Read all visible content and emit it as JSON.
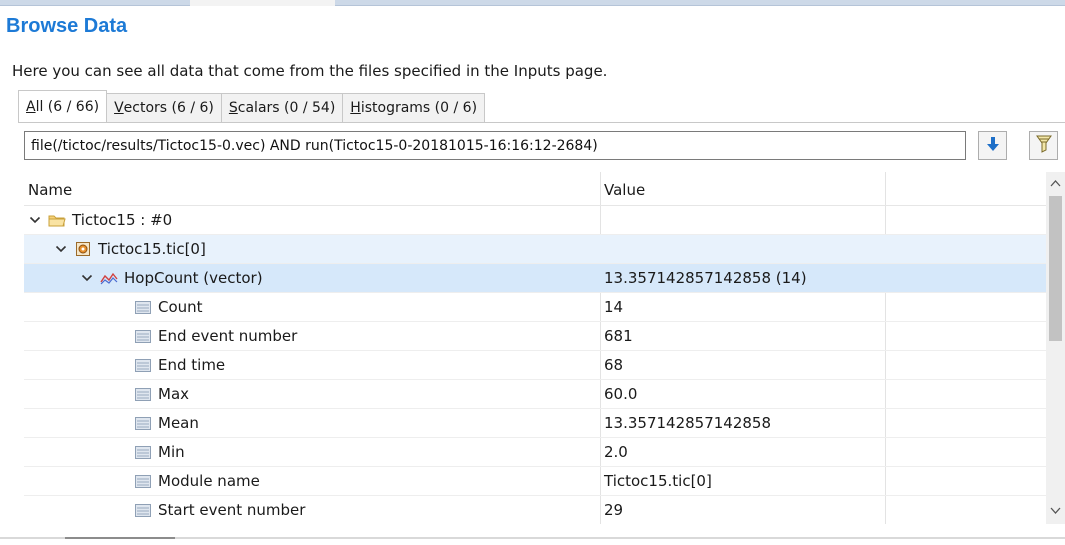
{
  "page": {
    "title": "Browse Data",
    "description": "Here you can see all data that come from the files specified in the Inputs page."
  },
  "tabs": [
    {
      "label_mnemonic": "A",
      "label_rest": "ll (6 / 66)",
      "active": true
    },
    {
      "label_mnemonic": "V",
      "label_rest": "ectors (6 / 6)",
      "active": false
    },
    {
      "label_mnemonic": "S",
      "label_rest": "calars (0 / 54)",
      "active": false
    },
    {
      "label_mnemonic": "H",
      "label_rest": "istograms (0 / 6)",
      "active": false
    }
  ],
  "filter": {
    "value": "file(/tictoc/results/Tictoc15-0.vec) AND run(Tictoc15-0-20181015-16:16:12-2684)"
  },
  "table": {
    "columns": {
      "name": "Name",
      "value": "Value"
    },
    "rows": [
      {
        "level": 0,
        "expander": "expanded",
        "icon": "folder-icon",
        "name": "Tictoc15 : #0",
        "value": ""
      },
      {
        "level": 1,
        "expander": "expanded",
        "icon": "module-icon",
        "name": "Tictoc15.tic[0]",
        "value": ""
      },
      {
        "level": 2,
        "expander": "expanded",
        "icon": "vector-icon",
        "name": "HopCount (vector)",
        "value": "13.357142857142858 (14)"
      },
      {
        "level": 3,
        "expander": "none",
        "icon": "field-icon",
        "name": "Count",
        "value": "14"
      },
      {
        "level": 3,
        "expander": "none",
        "icon": "field-icon",
        "name": "End event number",
        "value": "681"
      },
      {
        "level": 3,
        "expander": "none",
        "icon": "field-icon",
        "name": "End time",
        "value": "68"
      },
      {
        "level": 3,
        "expander": "none",
        "icon": "field-icon",
        "name": "Max",
        "value": "60.0"
      },
      {
        "level": 3,
        "expander": "none",
        "icon": "field-icon",
        "name": "Mean",
        "value": "13.357142857142858"
      },
      {
        "level": 3,
        "expander": "none",
        "icon": "field-icon",
        "name": "Min",
        "value": "2.0"
      },
      {
        "level": 3,
        "expander": "none",
        "icon": "field-icon",
        "name": "Module name",
        "value": "Tictoc15.tic[0]"
      },
      {
        "level": 3,
        "expander": "none",
        "icon": "field-icon",
        "name": "Start event number",
        "value": "29"
      }
    ]
  },
  "toolbar": {
    "apply_icon": "arrow-down-icon",
    "filter_icon": "funnel-icon"
  },
  "colors": {
    "title": "#1d7ad6",
    "selected_row": "#d6e8fa",
    "hover_row": "#e8f2fc"
  }
}
